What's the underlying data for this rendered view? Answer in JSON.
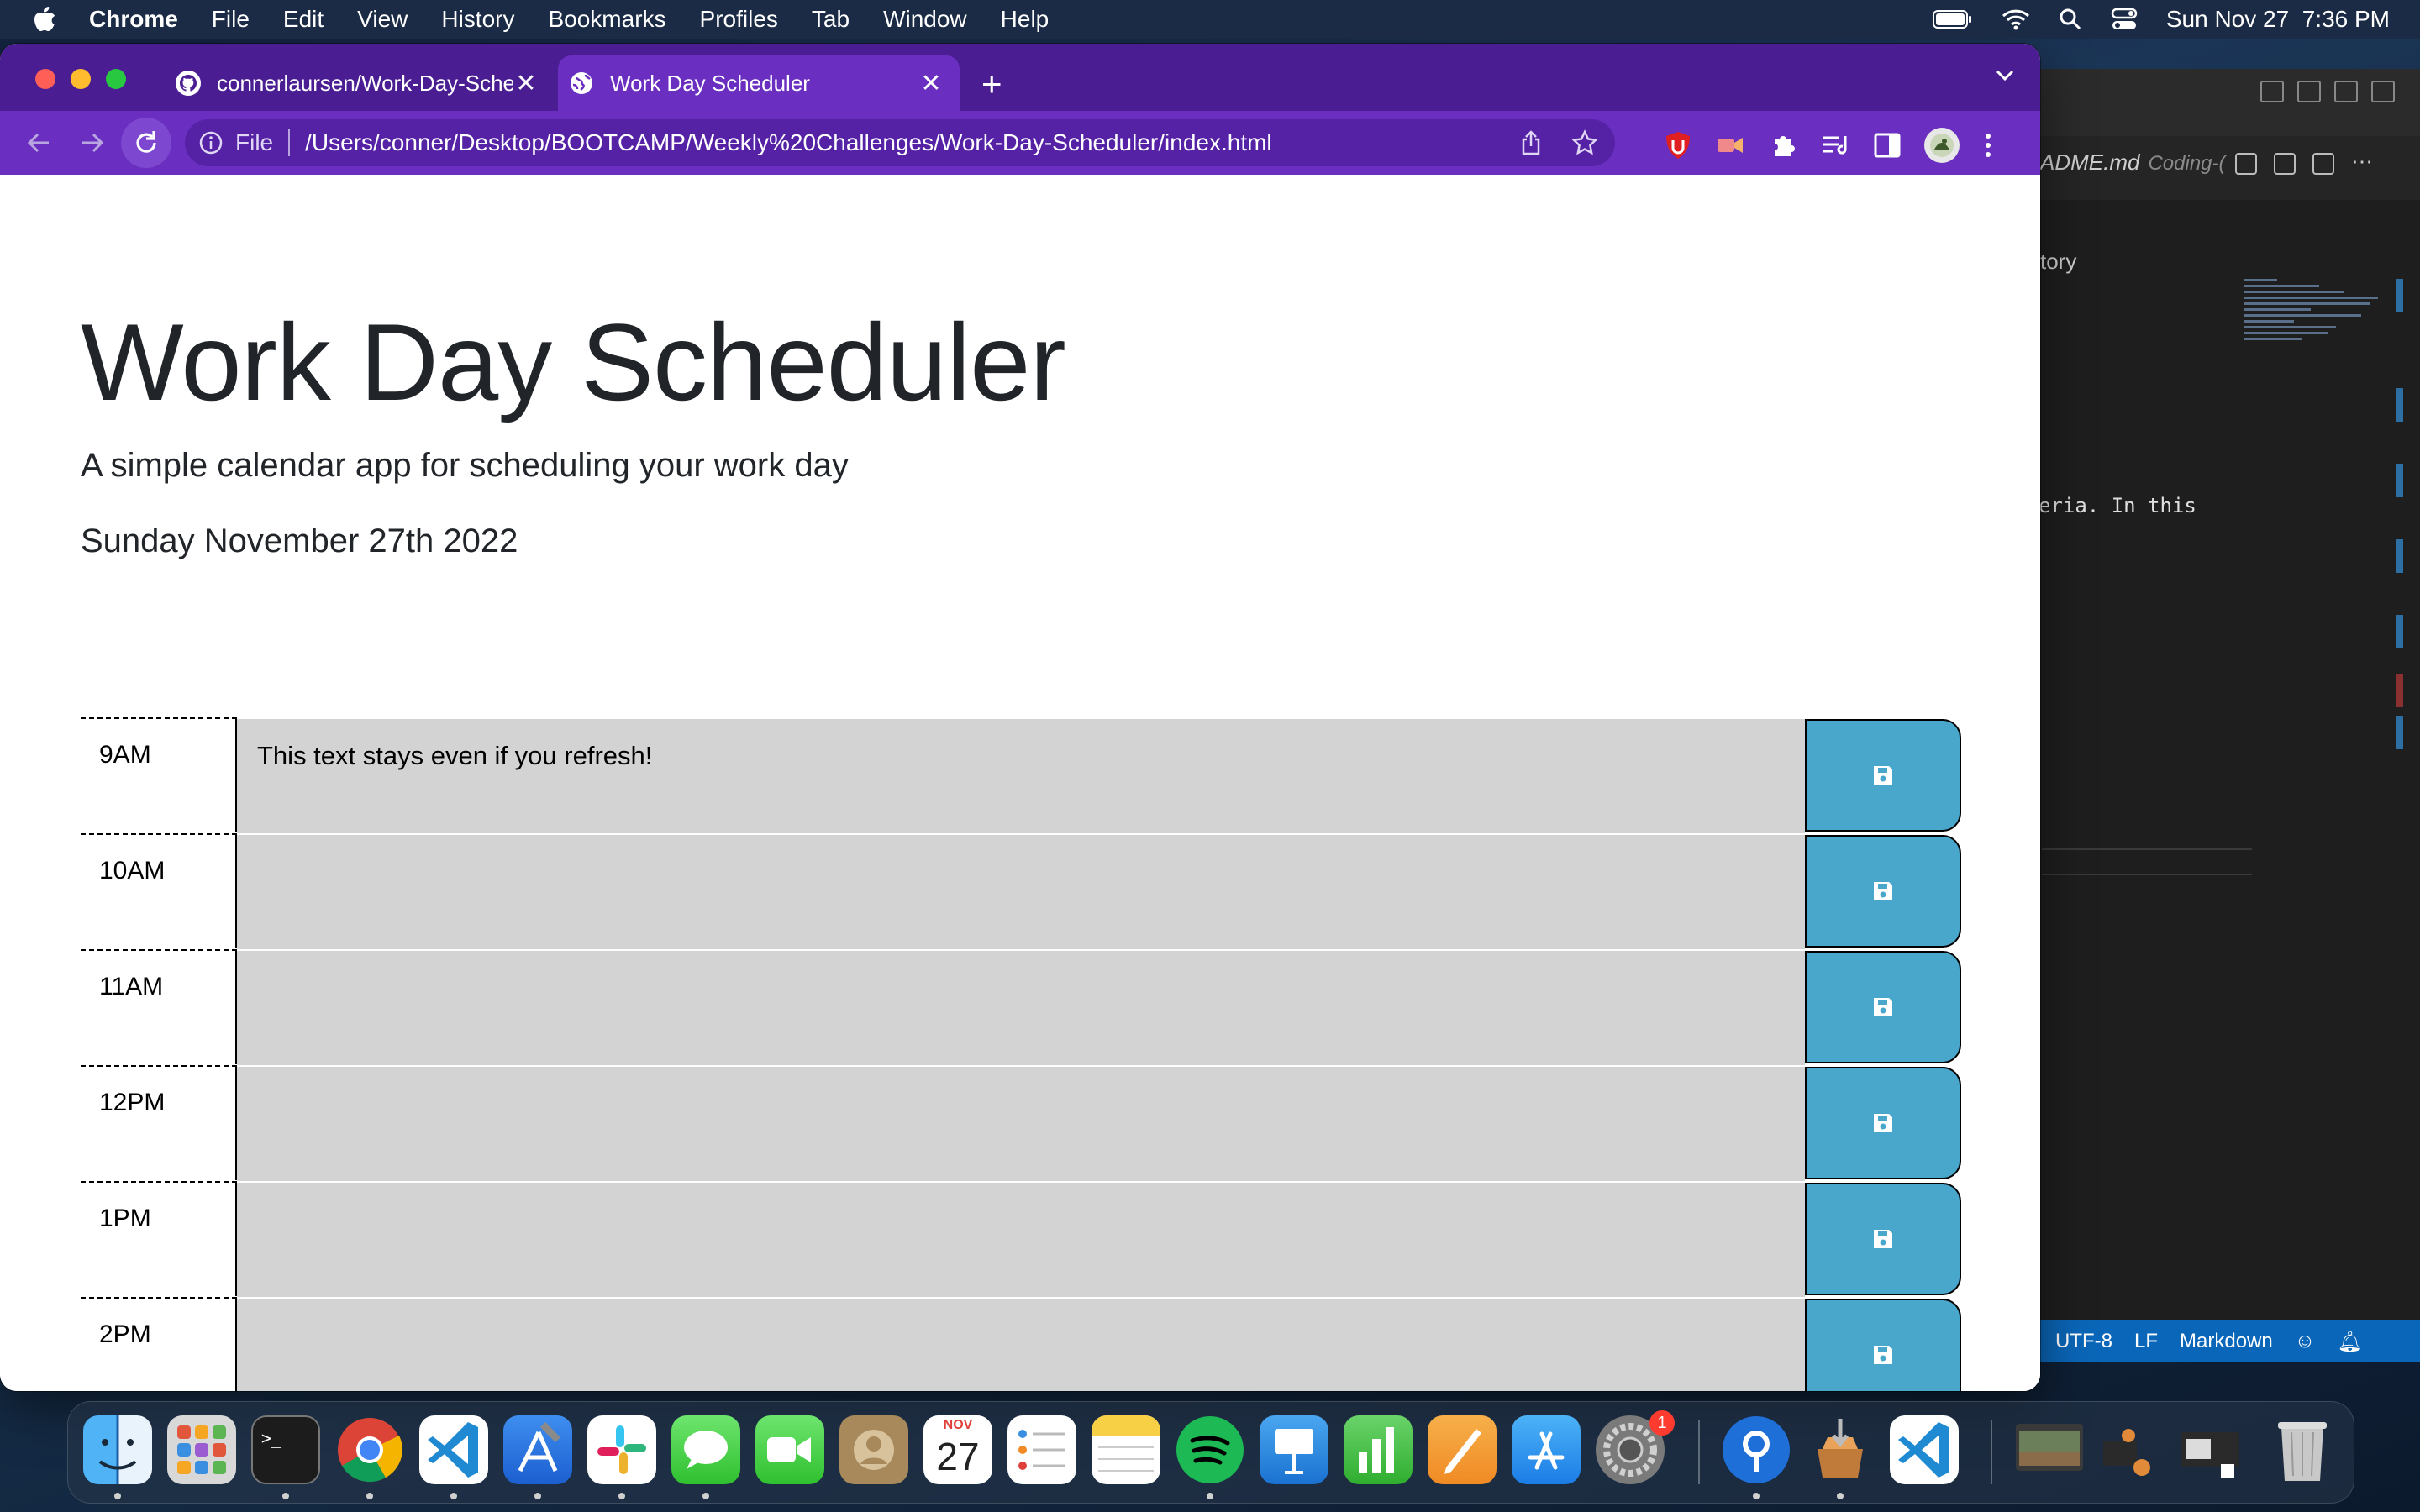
{
  "menubar": {
    "items": [
      "Chrome",
      "File",
      "Edit",
      "View",
      "History",
      "Bookmarks",
      "Profiles",
      "Tab",
      "Window",
      "Help"
    ],
    "datetime": "Sun Nov 27  7:36 PM"
  },
  "browser": {
    "tabs": [
      {
        "title": "connerlaursen/Work-Day-Sche",
        "active": false,
        "icon": "github-icon"
      },
      {
        "title": "Work Day Scheduler",
        "active": true,
        "icon": "globe-icon"
      }
    ],
    "address": {
      "scheme": "File",
      "url": "/Users/conner/Desktop/BOOTCAMP/Weekly%20Challenges/Work-Day-Scheduler/index.html"
    },
    "colors": {
      "tabstrip": "#4a1e92",
      "toolbar": "#6a2fc0"
    }
  },
  "page": {
    "title": "Work Day Scheduler",
    "lead": "A simple calendar app for scheduling your work day",
    "current_day": "Sunday November 27th 2022",
    "hours": [
      {
        "label": "9AM",
        "text": "This text stays even if you refresh!"
      },
      {
        "label": "10AM",
        "text": ""
      },
      {
        "label": "11AM",
        "text": ""
      },
      {
        "label": "12PM",
        "text": ""
      },
      {
        "label": "1PM",
        "text": ""
      },
      {
        "label": "2PM",
        "text": ""
      }
    ],
    "colors": {
      "row_bg": "#d3d3d3",
      "save_bg": "#4aa7cc"
    }
  },
  "vscode": {
    "tab_file": "ADME.md",
    "tab_extra": "Coding-(",
    "history_label": "tory",
    "code_snippet": "eria. In this",
    "status": [
      "UTF-8",
      "LF",
      "Markdown"
    ]
  },
  "dock": {
    "calendar_month": "NOV",
    "calendar_day": "27",
    "settings_badge": "1",
    "apps": [
      "Finder",
      "Launchpad",
      "Terminal",
      "Chrome",
      "VS Code",
      "Xcode",
      "Slack",
      "Messages",
      "FaceTime",
      "Contacts",
      "Calendar",
      "Reminders",
      "Notes",
      "Spotify",
      "Keynote",
      "Numbers",
      "Pages",
      "App Store",
      "System Preferences",
      "Sourcetree",
      "Installer",
      "VS Code",
      "Trash"
    ]
  }
}
